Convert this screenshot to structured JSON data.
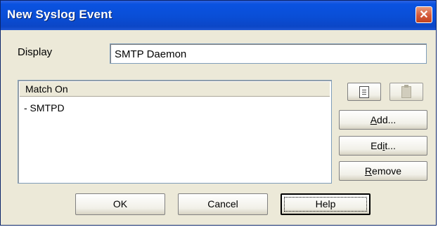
{
  "window": {
    "title": "New Syslog Event",
    "close_glyph": "✕"
  },
  "display": {
    "label": "Display",
    "value": "SMTP Daemon"
  },
  "match_list": {
    "header": "Match On",
    "items": [
      "- SMTPD"
    ]
  },
  "side_buttons": {
    "copy_icon": "copy-icon",
    "paste_icon": "paste-icon",
    "add_prefix": "",
    "add_underline": "A",
    "add_suffix": "dd...",
    "edit_prefix": "Ed",
    "edit_underline": "i",
    "edit_suffix": "t...",
    "remove_prefix": "",
    "remove_underline": "R",
    "remove_suffix": "emove"
  },
  "footer": {
    "ok": "OK",
    "cancel": "Cancel",
    "help": "Help"
  }
}
